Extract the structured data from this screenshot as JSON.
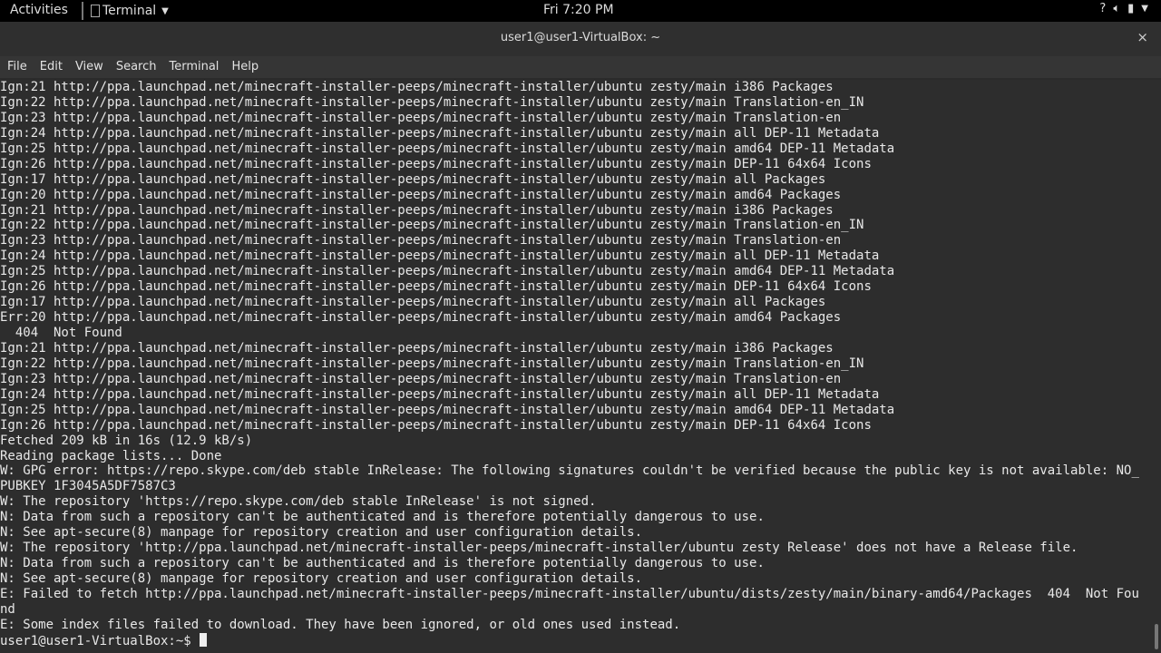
{
  "topbar": {
    "activities": "Activities",
    "app_name": "Terminal",
    "clock": "Fri  7:20 PM"
  },
  "window": {
    "title": "user1@user1-VirtualBox: ~",
    "close": "×"
  },
  "menu": {
    "file": "File",
    "edit": "Edit",
    "view": "View",
    "search": "Search",
    "terminal": "Terminal",
    "help": "Help"
  },
  "terminal": {
    "lines": [
      "Ign:21 http://ppa.launchpad.net/minecraft-installer-peeps/minecraft-installer/ubuntu zesty/main i386 Packages",
      "Ign:22 http://ppa.launchpad.net/minecraft-installer-peeps/minecraft-installer/ubuntu zesty/main Translation-en_IN",
      "Ign:23 http://ppa.launchpad.net/minecraft-installer-peeps/minecraft-installer/ubuntu zesty/main Translation-en",
      "Ign:24 http://ppa.launchpad.net/minecraft-installer-peeps/minecraft-installer/ubuntu zesty/main all DEP-11 Metadata",
      "Ign:25 http://ppa.launchpad.net/minecraft-installer-peeps/minecraft-installer/ubuntu zesty/main amd64 DEP-11 Metadata",
      "Ign:26 http://ppa.launchpad.net/minecraft-installer-peeps/minecraft-installer/ubuntu zesty/main DEP-11 64x64 Icons",
      "Ign:17 http://ppa.launchpad.net/minecraft-installer-peeps/minecraft-installer/ubuntu zesty/main all Packages",
      "Ign:20 http://ppa.launchpad.net/minecraft-installer-peeps/minecraft-installer/ubuntu zesty/main amd64 Packages",
      "Ign:21 http://ppa.launchpad.net/minecraft-installer-peeps/minecraft-installer/ubuntu zesty/main i386 Packages",
      "Ign:22 http://ppa.launchpad.net/minecraft-installer-peeps/minecraft-installer/ubuntu zesty/main Translation-en_IN",
      "Ign:23 http://ppa.launchpad.net/minecraft-installer-peeps/minecraft-installer/ubuntu zesty/main Translation-en",
      "Ign:24 http://ppa.launchpad.net/minecraft-installer-peeps/minecraft-installer/ubuntu zesty/main all DEP-11 Metadata",
      "Ign:25 http://ppa.launchpad.net/minecraft-installer-peeps/minecraft-installer/ubuntu zesty/main amd64 DEP-11 Metadata",
      "Ign:26 http://ppa.launchpad.net/minecraft-installer-peeps/minecraft-installer/ubuntu zesty/main DEP-11 64x64 Icons",
      "Ign:17 http://ppa.launchpad.net/minecraft-installer-peeps/minecraft-installer/ubuntu zesty/main all Packages",
      "Err:20 http://ppa.launchpad.net/minecraft-installer-peeps/minecraft-installer/ubuntu zesty/main amd64 Packages",
      "  404  Not Found",
      "Ign:21 http://ppa.launchpad.net/minecraft-installer-peeps/minecraft-installer/ubuntu zesty/main i386 Packages",
      "Ign:22 http://ppa.launchpad.net/minecraft-installer-peeps/minecraft-installer/ubuntu zesty/main Translation-en_IN",
      "Ign:23 http://ppa.launchpad.net/minecraft-installer-peeps/minecraft-installer/ubuntu zesty/main Translation-en",
      "Ign:24 http://ppa.launchpad.net/minecraft-installer-peeps/minecraft-installer/ubuntu zesty/main all DEP-11 Metadata",
      "Ign:25 http://ppa.launchpad.net/minecraft-installer-peeps/minecraft-installer/ubuntu zesty/main amd64 DEP-11 Metadata",
      "Ign:26 http://ppa.launchpad.net/minecraft-installer-peeps/minecraft-installer/ubuntu zesty/main DEP-11 64x64 Icons",
      "Fetched 209 kB in 16s (12.9 kB/s)",
      "Reading package lists... Done",
      "W: GPG error: https://repo.skype.com/deb stable InRelease: The following signatures couldn't be verified because the public key is not available: NO_",
      "PUBKEY 1F3045A5DF7587C3",
      "W: The repository 'https://repo.skype.com/deb stable InRelease' is not signed.",
      "N: Data from such a repository can't be authenticated and is therefore potentially dangerous to use.",
      "N: See apt-secure(8) manpage for repository creation and user configuration details.",
      "W: The repository 'http://ppa.launchpad.net/minecraft-installer-peeps/minecraft-installer/ubuntu zesty Release' does not have a Release file.",
      "N: Data from such a repository can't be authenticated and is therefore potentially dangerous to use.",
      "N: See apt-secure(8) manpage for repository creation and user configuration details.",
      "E: Failed to fetch http://ppa.launchpad.net/minecraft-installer-peeps/minecraft-installer/ubuntu/dists/zesty/main/binary-amd64/Packages  404  Not Fou",
      "nd",
      "E: Some index files failed to download. They have been ignored, or old ones used instead."
    ],
    "prompt": "user1@user1-VirtualBox:~$ "
  }
}
